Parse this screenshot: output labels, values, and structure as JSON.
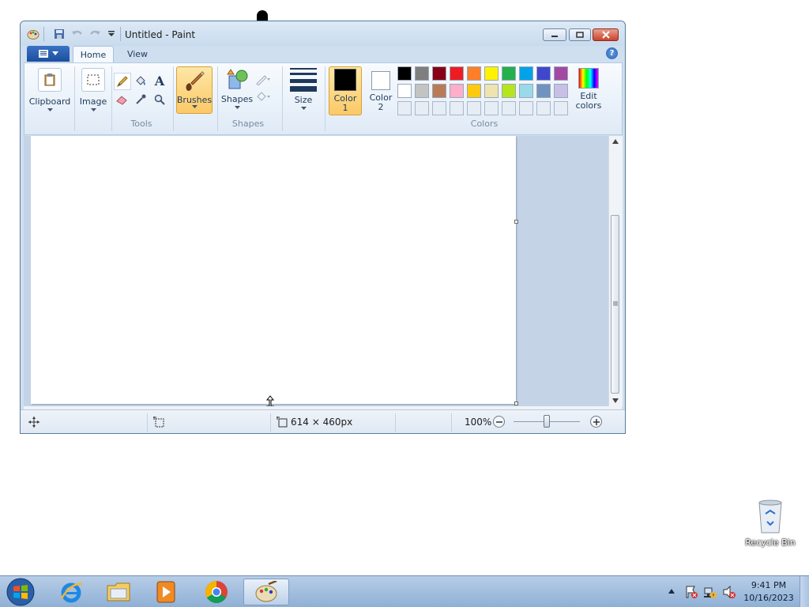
{
  "window": {
    "title": "Untitled - Paint",
    "tabs": [
      {
        "label": "Home"
      },
      {
        "label": "View"
      }
    ],
    "help_label": "?"
  },
  "ribbon": {
    "clipboard_label": "Clipboard",
    "image_label": "Image",
    "tools_label": "Tools",
    "brushes_label": "Brushes",
    "shapes_btn_label": "Shapes",
    "shapes_group_label": "Shapes",
    "size_label": "Size",
    "color1_label_1": "Color",
    "color1_label_2": "1",
    "color2_label_1": "Color",
    "color2_label_2": "2",
    "edit_colors_1": "Edit",
    "edit_colors_2": "colors",
    "colors_group_label": "Colors",
    "palette_row1": [
      "#000000",
      "#7f7f7f",
      "#880015",
      "#ed1c24",
      "#ff7f27",
      "#fff200",
      "#22b14c",
      "#00a2e8",
      "#3f48cc",
      "#a349a4"
    ],
    "palette_row2": [
      "#ffffff",
      "#c3c3c3",
      "#b97a57",
      "#ffaec9",
      "#ffc90e",
      "#efe4b0",
      "#b5e61d",
      "#99d9ea",
      "#7092be",
      "#c8bfe7"
    ],
    "color1": "#000000",
    "color2": "#ffffff"
  },
  "status": {
    "canvas_size": "614 × 460px",
    "zoom": "100%",
    "zoom_level": 1.0
  },
  "desktop": {
    "recycle_bin_label": "Recycle Bin"
  },
  "taskbar": {
    "time": "9:41 PM",
    "date": "10/16/2023"
  }
}
